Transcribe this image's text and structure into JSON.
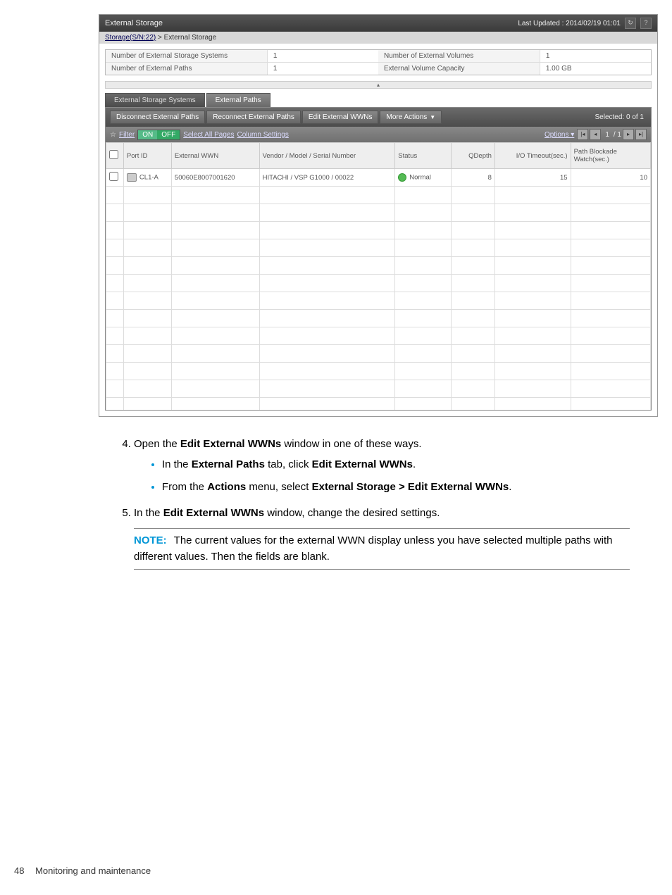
{
  "header": {
    "title": "External Storage",
    "lastUpdated": "Last Updated : 2014/02/19 01:01"
  },
  "breadcrumb": {
    "link": "Storage(S/N:22)",
    "sep": " > ",
    "current": "External Storage"
  },
  "summary": [
    {
      "label": "Number of External Storage Systems",
      "value": "1"
    },
    {
      "label": "Number of External Paths",
      "value": "1"
    },
    {
      "label": "Number of External Volumes",
      "value": "1"
    },
    {
      "label": "External Volume Capacity",
      "value": "1.00 GB"
    }
  ],
  "tabs": {
    "systems": "External Storage Systems",
    "paths": "External Paths"
  },
  "actions": {
    "disconnect": "Disconnect External Paths",
    "reconnect": "Reconnect External Paths",
    "editWwn": "Edit External WWNs",
    "more": "More Actions",
    "selected": "Selected: 0 of 1"
  },
  "filterbar": {
    "filter": "Filter",
    "on": "ON",
    "off": "OFF",
    "selectAll": "Select All Pages",
    "colSettings": "Column Settings",
    "options": "Options",
    "page": "1",
    "pageTotal": "/ 1"
  },
  "columns": [
    "",
    "Port ID",
    "External WWN",
    "Vendor / Model / Serial Number",
    "Status",
    "QDepth",
    "I/O Timeout(sec.)",
    "Path Blockade Watch(sec.)"
  ],
  "rows": [
    {
      "port": "CL1-A",
      "wwn": "50060E8007001620",
      "vendor": "HITACHI / VSP G1000 / 00022",
      "status": "Normal",
      "qdepth": "8",
      "timeout": "15",
      "blockade": "10"
    }
  ],
  "doc": {
    "step4": "Open the ",
    "step4b": "Edit External WWNs",
    "step4c": " window in one of these ways.",
    "bullet1a": "In the ",
    "bullet1b": "External Paths",
    "bullet1c": " tab, click ",
    "bullet1d": "Edit External WWNs",
    "bullet1e": ".",
    "bullet2a": "From the ",
    "bullet2b": "Actions",
    "bullet2c": " menu, select ",
    "bullet2d": " External Storage > Edit External WWNs",
    "bullet2e": ".",
    "step5a": "In the ",
    "step5b": "Edit External WWNs",
    "step5c": " window, change the desired settings.",
    "noteLabel": "NOTE:",
    "noteBody": "The current values for the external WWN display unless you have selected multiple paths with different values. Then the fields are blank."
  },
  "footer": {
    "page": "48",
    "section": "Monitoring and maintenance"
  }
}
